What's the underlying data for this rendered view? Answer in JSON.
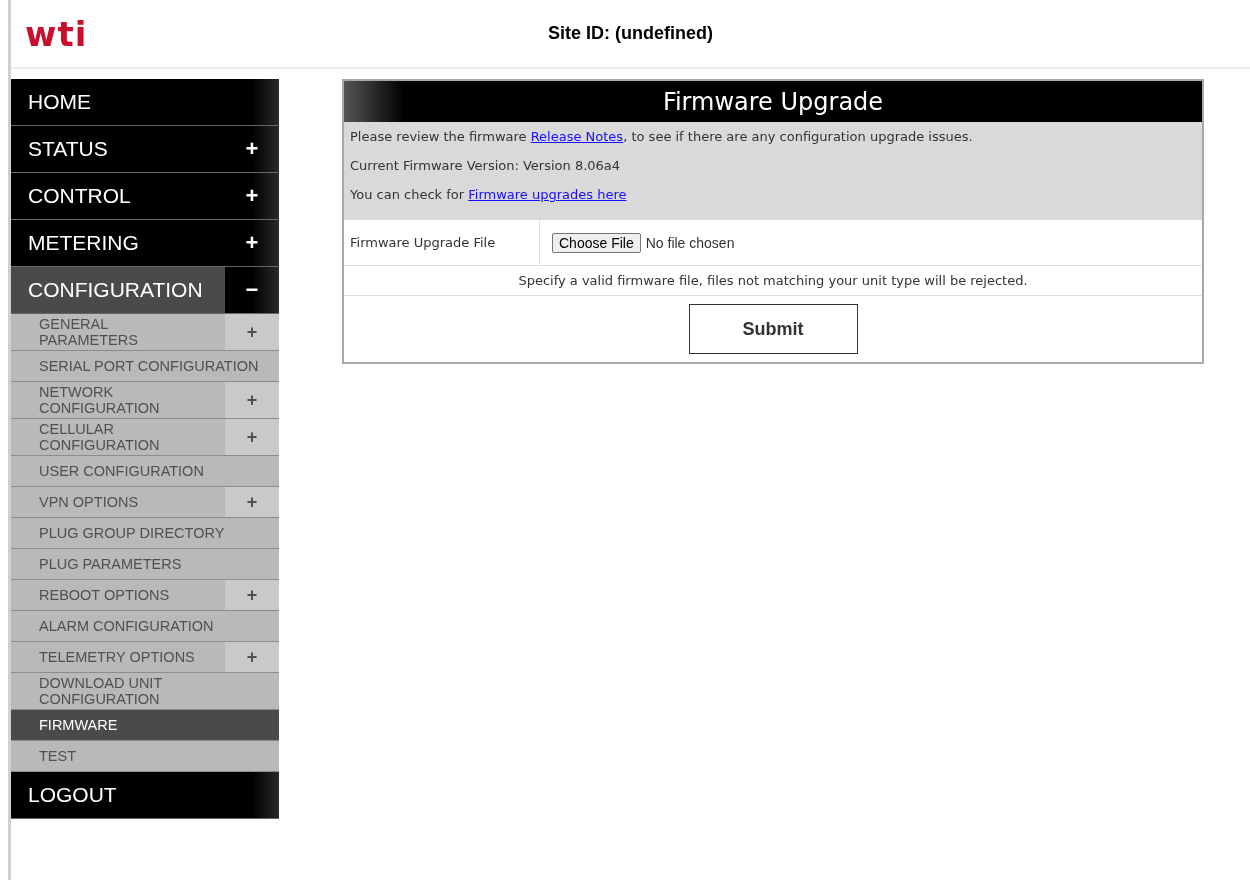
{
  "header": {
    "logo": "wti",
    "site_id": "Site ID: (undefined)"
  },
  "nav": [
    {
      "label": "HOME",
      "expanded": false
    },
    {
      "label": "STATUS",
      "toggle": "+",
      "expanded": false
    },
    {
      "label": "CONTROL",
      "toggle": "+",
      "expanded": false
    },
    {
      "label": "METERING",
      "toggle": "+",
      "expanded": false
    },
    {
      "label": "CONFIGURATION",
      "toggle": "−",
      "expanded": true,
      "children": [
        {
          "label": "GENERAL PARAMETERS",
          "toggle": "+",
          "selected": false
        },
        {
          "label": "SERIAL PORT CONFIGURATION",
          "selected": false
        },
        {
          "label": "NETWORK CONFIGURATION",
          "toggle": "+",
          "selected": false
        },
        {
          "label": "CELLULAR CONFIGURATION",
          "toggle": "+",
          "selected": false
        },
        {
          "label": "USER CONFIGURATION",
          "selected": false
        },
        {
          "label": "VPN OPTIONS",
          "toggle": "+",
          "selected": false
        },
        {
          "label": "PLUG GROUP DIRECTORY",
          "selected": false
        },
        {
          "label": "PLUG PARAMETERS",
          "selected": false
        },
        {
          "label": "REBOOT OPTIONS",
          "toggle": "+",
          "selected": false
        },
        {
          "label": "ALARM CONFIGURATION",
          "selected": false
        },
        {
          "label": "TELEMETRY OPTIONS",
          "toggle": "+",
          "selected": false
        },
        {
          "label": "DOWNLOAD UNIT CONFIGURATION",
          "selected": false
        },
        {
          "label": "FIRMWARE",
          "selected": true
        },
        {
          "label": "TEST",
          "selected": false
        }
      ]
    },
    {
      "label": "LOGOUT",
      "expanded": false
    }
  ],
  "panel": {
    "title": "Firmware Upgrade",
    "info": [
      {
        "before": "Please review the firmware ",
        "link": "Release Notes",
        "after": ", to see if there are any configuration upgrade issues."
      },
      {
        "before": "Current Firmware Version: Version 8.06a4"
      },
      {
        "before": "You can check for ",
        "link": "Firmware upgrades here"
      }
    ],
    "file_row": {
      "label": "Firmware Upgrade File",
      "button": "Choose File",
      "status": "No file chosen"
    },
    "note": "Specify a valid firmware file, files not matching your unit type will be rejected.",
    "submit": "Submit"
  }
}
